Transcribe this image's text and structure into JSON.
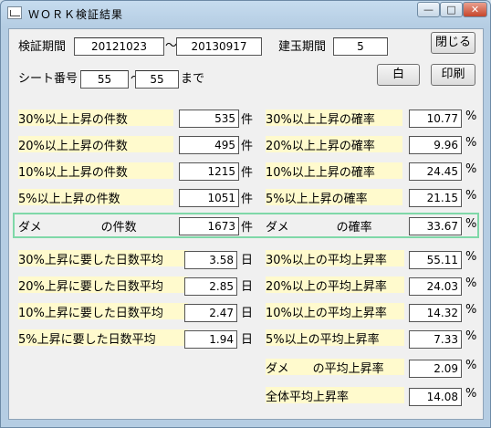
{
  "window": {
    "title": "ＷＯＲＫ検証結果",
    "minimize_label": "—",
    "maximize_label": "□",
    "close_label": "✕"
  },
  "header": {
    "period_label": "検証期間",
    "period_from": "20121023",
    "tilde": "〜",
    "period_to": "20130917",
    "holding_label": "建玉期間",
    "holding_value": "5",
    "close_button": "閉じる",
    "sheet_label": "シート番号",
    "sheet_from": "55",
    "sheet_to": "55",
    "made": "まで",
    "white_button": "白",
    "print_button": "印刷"
  },
  "units": {
    "count": "件",
    "percent": "%",
    "day": "日"
  },
  "stats": [
    {
      "left_label": "30%以上上昇の件数",
      "left_value": "535",
      "right_label": "30%以上上昇の確率",
      "right_value": "10.77"
    },
    {
      "left_label": "20%以上上昇の件数",
      "left_value": "495",
      "right_label": "20%以上上昇の確率",
      "right_value": "9.96"
    },
    {
      "left_label": "10%以上上昇の件数",
      "left_value": "1215",
      "right_label": "10%以上上昇の確率",
      "right_value": "24.45"
    },
    {
      "left_label": " 5%以上上昇の件数",
      "left_value": "1051",
      "right_label": " 5%以上上昇の確率",
      "right_value": "21.15"
    },
    {
      "left_label": "ダメ　　　　　の件数",
      "left_value": "1673",
      "right_label": "ダメ　　　　の確率",
      "right_value": "33.67"
    }
  ],
  "days": [
    {
      "left_label": "30%上昇に要した日数平均",
      "left_value": "3.58",
      "right_label": "30%以上の平均上昇率",
      "right_value": "55.11"
    },
    {
      "left_label": "20%上昇に要した日数平均",
      "left_value": "2.85",
      "right_label": "20%以上の平均上昇率",
      "right_value": "24.03"
    },
    {
      "left_label": "10%上昇に要した日数平均",
      "left_value": "2.47",
      "right_label": "10%以上の平均上昇率",
      "right_value": "14.32"
    },
    {
      "left_label": " 5%上昇に要した日数平均",
      "left_value": "1.94",
      "right_label": " 5%以上の平均上昇率",
      "right_value": "7.33"
    }
  ],
  "extra": [
    {
      "label": "ダメ　　の平均上昇率",
      "value": "2.09"
    },
    {
      "label": "全体平均上昇率",
      "value": "14.08"
    }
  ]
}
